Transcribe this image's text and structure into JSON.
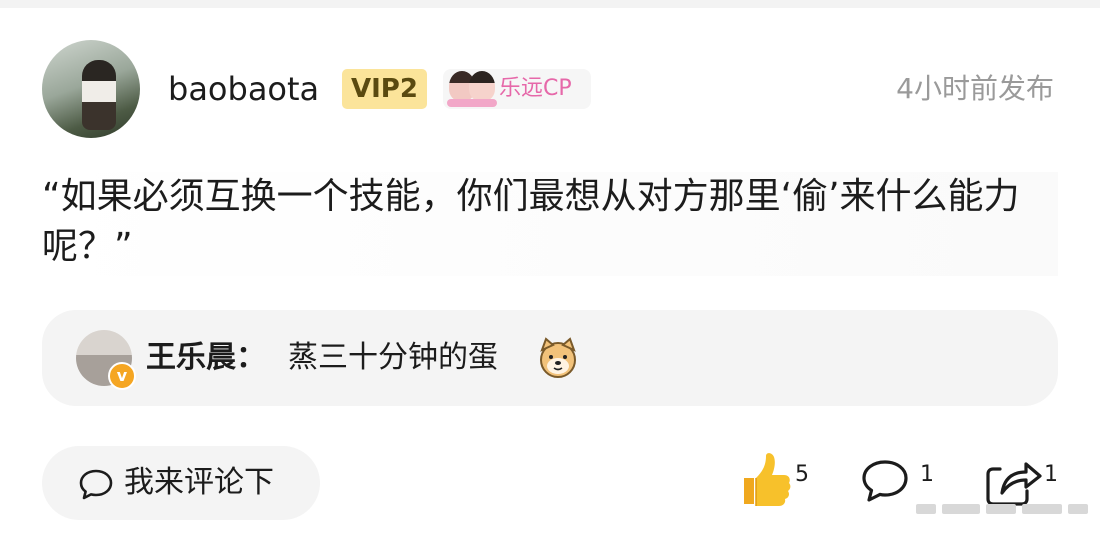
{
  "header": {
    "username": "baobaota",
    "vip_label": "VIP2",
    "cp_label": "乐远CP",
    "time": "4小时前发布"
  },
  "post": {
    "text": "“如果必须互换一个技能，你们最想从对方那里‘偷’来什么能力呢？”"
  },
  "reply": {
    "name": "王乐晨：",
    "content": "蒸三十分钟的蛋",
    "emoji": "dog-face-icon"
  },
  "footer": {
    "comment_placeholder": "我来评论下",
    "like_count": "5",
    "comment_count": "1",
    "share_count": "1"
  },
  "colors": {
    "vip_bg": "#fbe49a",
    "cp_text": "#e668a9",
    "like_yellow": "#f7c12b",
    "time_gray": "#9a9a9a",
    "panel_bg": "#f4f4f4"
  }
}
